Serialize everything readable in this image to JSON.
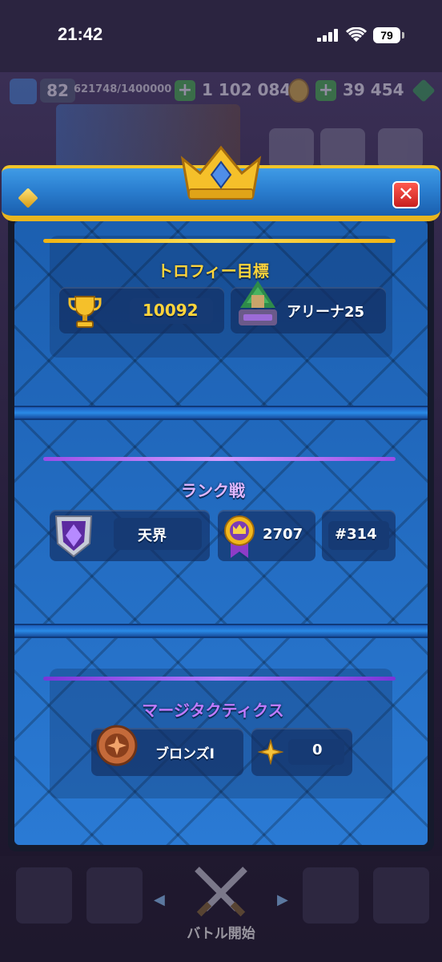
{
  "status_bar": {
    "time": "21:42",
    "battery": "79"
  },
  "background": {
    "level": "82",
    "xp": "621748/1400000",
    "gold": "1 102 084",
    "gems": "39 454",
    "battle_label": "バトル開始"
  },
  "modal": {
    "trophy_section": {
      "title": "トロフィー目標",
      "trophies": "10092",
      "arena": "アリーナ25"
    },
    "ranked_section": {
      "title": "ランク戦",
      "league": "天界",
      "medals": "2707",
      "rank": "#314"
    },
    "merge_tactics_section": {
      "title": "マージタクティクス",
      "league": "ブロンズI",
      "stars": "0"
    }
  },
  "colors": {
    "header_blue": "#2b7fd0",
    "gold_accent": "#f1c52a",
    "trophy_title": "#ffd43b",
    "ranked_title": "#e0b7ff",
    "merge_title": "#c07bff",
    "trophy_line": "#f4c21e",
    "ranked_line": "#b56cf5",
    "merge_line": "#8d46e8",
    "close_red": "#d32a22"
  },
  "icons": [
    "signal-icon",
    "wifi-icon",
    "battery-icon",
    "crown-icon",
    "diamond-icon",
    "close-icon",
    "trophy-icon",
    "arena-icon",
    "rank-shield-icon",
    "medal-icon",
    "bronze-badge-icon",
    "star-icon",
    "swords-icon"
  ]
}
